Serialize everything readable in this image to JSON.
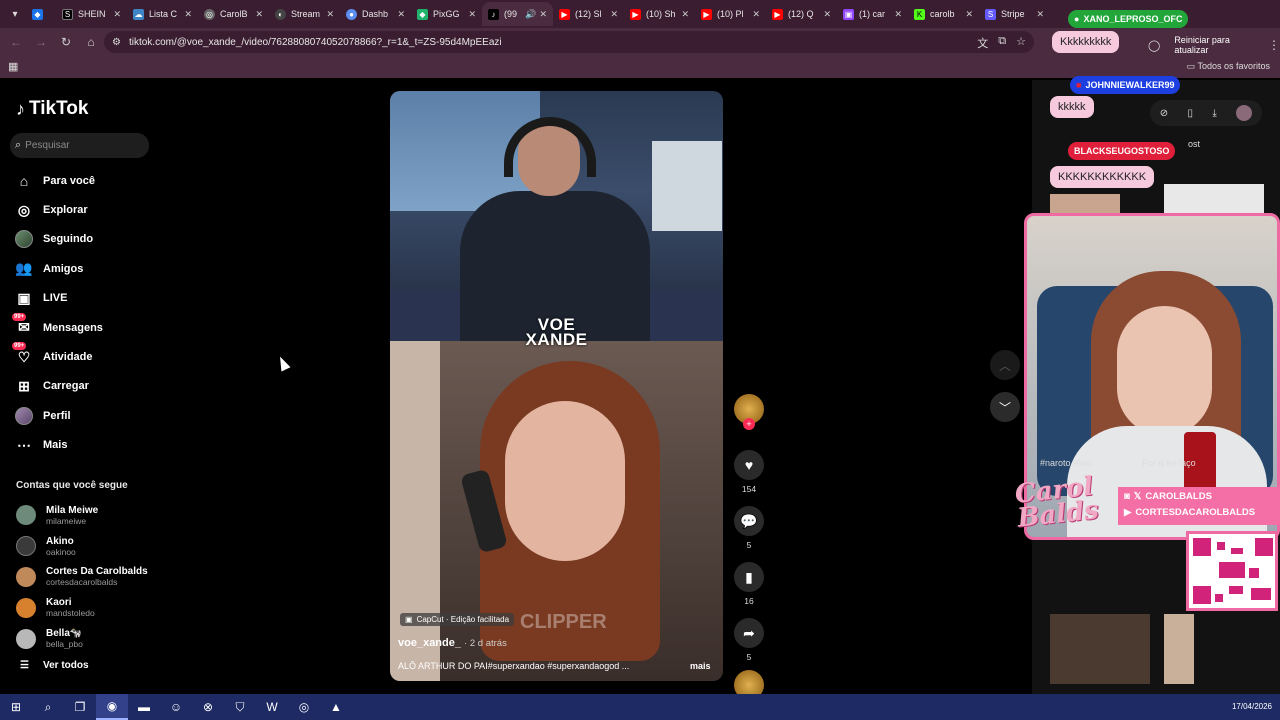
{
  "browser": {
    "tabs": [
      {
        "label": "",
        "color": "#1a73e8",
        "icon": "drop-icon"
      },
      {
        "label": "SHEIN",
        "color": "#000000",
        "icon": "shein-icon"
      },
      {
        "label": "Lista C",
        "color": "#3d85c6",
        "icon": "cloud-icon"
      },
      {
        "label": "CarolB",
        "color": "#888888",
        "icon": "globe-icon"
      },
      {
        "label": "Stream",
        "color": "#444444",
        "icon": "streamelements-icon"
      },
      {
        "label": "Dashb",
        "color": "#5a8dee",
        "icon": "dashboard-icon"
      },
      {
        "label": "PixGG",
        "color": "#1fb36b",
        "icon": "pix-icon"
      },
      {
        "label": "(99",
        "color": "#000000",
        "icon": "tiktok-icon"
      },
      {
        "label": "(12) Sl",
        "color": "#ff0000",
        "icon": "youtube-icon"
      },
      {
        "label": "(10) Sh",
        "color": "#ff0000",
        "icon": "youtube-icon"
      },
      {
        "label": "(10) Pl",
        "color": "#ff0000",
        "icon": "youtube-icon"
      },
      {
        "label": "(12) Q",
        "color": "#ff0000",
        "icon": "youtube-icon"
      },
      {
        "label": "(1) car",
        "color": "#9146ff",
        "icon": "twitch-icon"
      },
      {
        "label": "carolb",
        "color": "#53fc18",
        "icon": "kick-icon"
      },
      {
        "label": "Stripe",
        "color": "#635bff",
        "icon": "stripe-icon"
      }
    ],
    "url": "tiktok.com/@voe_xande_/video/7628808074052078866?_r=1&_t=ZS-95d4MpEEazi",
    "restart_label": "Reiniciar para atualizar",
    "all_favorites": "Todos os favoritos"
  },
  "sidebar": {
    "logo": "TikTok",
    "search_placeholder": "Pesquisar",
    "menu": [
      {
        "label": "Para você",
        "icon": "home-icon",
        "badge": ""
      },
      {
        "label": "Explorar",
        "icon": "compass-icon",
        "badge": ""
      },
      {
        "label": "Seguindo",
        "icon": "avatar-icon",
        "badge": ""
      },
      {
        "label": "Amigos",
        "icon": "friends-icon",
        "badge": ""
      },
      {
        "label": "LIVE",
        "icon": "live-icon",
        "badge": ""
      },
      {
        "label": "Mensagens",
        "icon": "inbox-icon",
        "badge": "99+"
      },
      {
        "label": "Atividade",
        "icon": "activity-icon",
        "badge": "99+"
      },
      {
        "label": "Carregar",
        "icon": "upload-icon",
        "badge": ""
      },
      {
        "label": "Perfil",
        "icon": "profile-icon",
        "badge": ""
      },
      {
        "label": "Mais",
        "icon": "more-icon",
        "badge": ""
      }
    ],
    "following_title": "Contas que você segue",
    "following": [
      {
        "name": "Mila Meiwe",
        "handle": "milameiwe",
        "color": "#6d8a7a"
      },
      {
        "name": "Akino",
        "handle": "oakinoo",
        "color": "#3a3a3a"
      },
      {
        "name": "Cortes Da Carolbalds",
        "handle": "cortesdacarolbalds",
        "color": "#c0895a"
      },
      {
        "name": "Kaori",
        "handle": "mandstoledo",
        "color": "#d7812e"
      },
      {
        "name": "Bella🐄",
        "handle": "bella_pbo",
        "color": "#b8b8b8"
      }
    ],
    "see_all": "Ver todos"
  },
  "video": {
    "overlay_title_1": "VOE",
    "overlay_title_2": "XANDE",
    "capcut_label": "CapCut · Edição facilitada",
    "author": "voe_xande_",
    "time": "· 2 d atrás",
    "caption": "ALÔ ARTHUR DO PAI#superxandao #superxandaogod ...",
    "more": "mais",
    "watermark": "CLIPPER"
  },
  "actions": {
    "likes": "154",
    "comments": "5",
    "saves": "16",
    "shares": "5"
  },
  "stream": {
    "chat": [
      {
        "user": "XANO_LEPROSO_OFC",
        "message": "Kkkkkkkkk",
        "badge_color": "#22a63a"
      },
      {
        "user": "JOHNNIEWALKER99",
        "message": "kkkkk",
        "badge_color": "#1d3fe0"
      },
      {
        "user": "BLACKSEUGOSTOSO",
        "message": "KKKKKKKKKKKK",
        "badge_color": "#e0203a"
      }
    ],
    "brand_name": "Carol Balds",
    "social_1": "CAROLBALDS",
    "social_2": "CORTESDACAROLBALDS",
    "under_cam_left": "#naroto #lain",
    "under_cam_right": "Por q eu faço",
    "partial_tab": "ost"
  },
  "taskbar": {
    "date": "17/04/2026"
  }
}
